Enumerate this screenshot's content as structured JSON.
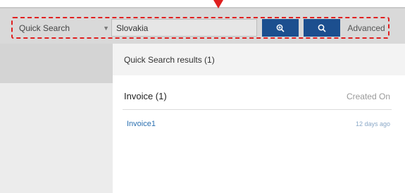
{
  "search_bar": {
    "scope_selected": "Quick Search",
    "query_value": "Slovakia",
    "advanced_label": "Advanced",
    "buttons": [
      {
        "icon": "zoom-in-icon"
      },
      {
        "icon": "search-icon"
      }
    ],
    "highlight_color": "#e02020",
    "button_color": "#1c4f8f"
  },
  "results": {
    "header": "Quick Search results (1)",
    "section": {
      "title": "Invoice (1)",
      "sort_label": "Created On"
    },
    "items": [
      {
        "name": "Invoice1",
        "date": "12 days ago"
      }
    ]
  }
}
